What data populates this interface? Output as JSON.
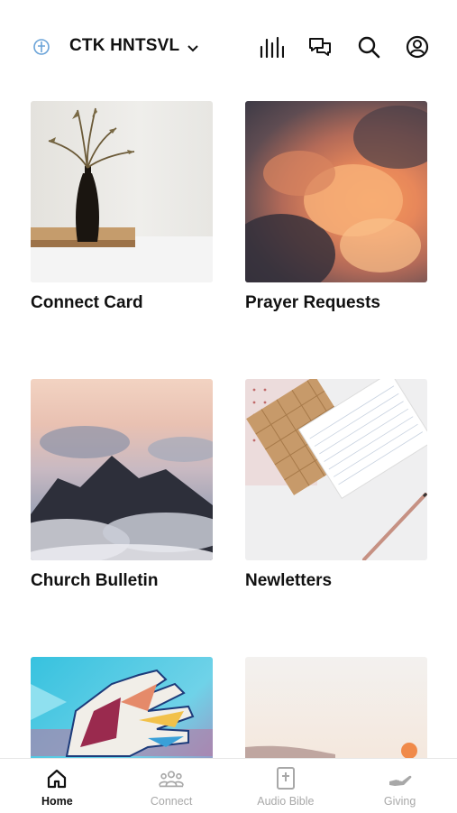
{
  "header": {
    "org_name": "CTK HNTSVL",
    "icons": [
      "logo-icon",
      "chevron-down-icon",
      "audio-bars-icon",
      "chat-icon",
      "search-icon",
      "account-icon"
    ]
  },
  "cards": [
    {
      "title": "Connect Card",
      "art": "vase-on-shelf"
    },
    {
      "title": "Prayer Requests",
      "art": "sunset-clouds"
    },
    {
      "title": "Church Bulletin",
      "art": "mountains-above-clouds"
    },
    {
      "title": "Newletters",
      "art": "notepad-and-pencil"
    },
    {
      "title": "",
      "art": "colorful-hands"
    },
    {
      "title": "",
      "art": "pale-sunset"
    }
  ],
  "tabs": [
    {
      "label": "Home",
      "icon": "home-icon",
      "active": true
    },
    {
      "label": "Connect",
      "icon": "people-icon",
      "active": false
    },
    {
      "label": "Audio Bible",
      "icon": "bible-icon",
      "active": false
    },
    {
      "label": "Giving",
      "icon": "giving-hand-icon",
      "active": false
    }
  ],
  "colors": {
    "text": "#111111",
    "inactive": "#a8a8a8",
    "accent": "#6aa3d8"
  }
}
